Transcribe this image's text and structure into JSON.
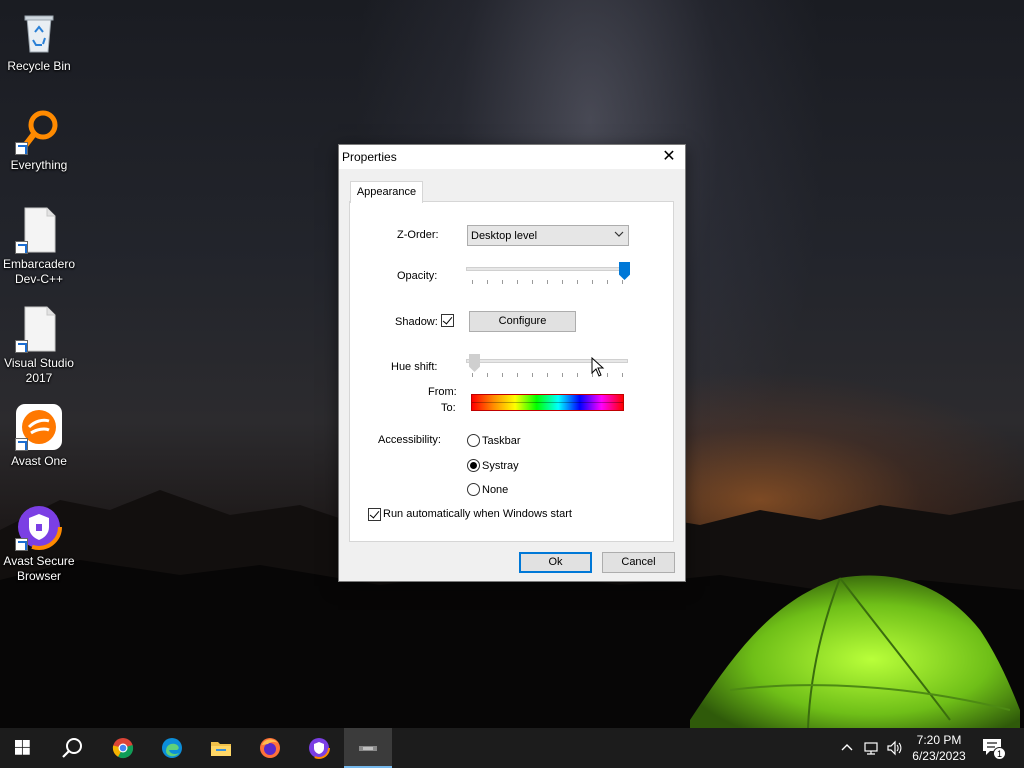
{
  "desktop": {
    "icons": [
      {
        "label": "Recycle Bin"
      },
      {
        "label": "Everything"
      },
      {
        "label": "Embarcadero Dev-C++"
      },
      {
        "label": "Visual Studio 2017"
      },
      {
        "label": "Avast One"
      },
      {
        "label": "Avast Secure Browser"
      }
    ]
  },
  "dialog": {
    "title": "Properties",
    "close_glyph": "✕",
    "tab_label": "Appearance",
    "zorder_label": "Z-Order:",
    "zorder_value": "Desktop level",
    "opacity_label": "Opacity:",
    "opacity_level": 1.0,
    "shadow_label": "Shadow:",
    "shadow_checked": true,
    "configure_label": "Configure",
    "hue_label": "Hue shift:",
    "hue_level": 0.0,
    "from_label": "From:",
    "to_label": "To:",
    "accessibility_label": "Accessibility:",
    "accessibility_options": [
      "Taskbar",
      "Systray",
      "None"
    ],
    "accessibility_selected": "Systray",
    "autorun_label": "Run automatically when Windows start",
    "autorun_checked": true,
    "ok_label": "Ok",
    "cancel_label": "Cancel",
    "hue_gradient_colors": [
      "#ff0000",
      "#ff8c00",
      "#ffff00",
      "#00ff00",
      "#00ffff",
      "#0000ff",
      "#ff00ff",
      "#ff0000"
    ]
  },
  "taskbar": {
    "apps": [
      "start-icon",
      "search-icon",
      "chrome-icon",
      "edge-icon",
      "file-explorer-icon",
      "firefox-icon",
      "avast-secure-browser-icon",
      "app-window-icon"
    ],
    "time": "7:20 PM",
    "date": "6/23/2023",
    "notification_count": "1"
  },
  "colors": {
    "accent": "#0078d7",
    "taskbar": "#1c1c1c",
    "dialog_bg": "#f0f0f0"
  }
}
